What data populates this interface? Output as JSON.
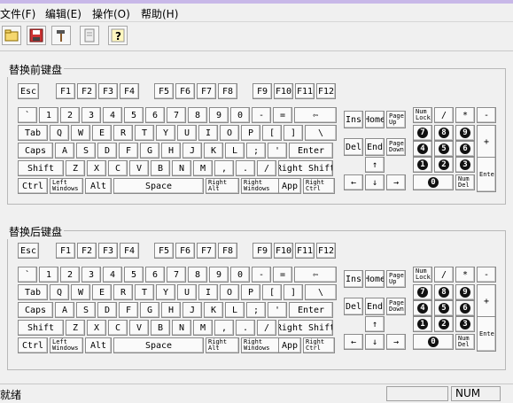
{
  "menu": [
    "文件(F)",
    "编辑(E)",
    "操作(O)",
    "帮助(H)"
  ],
  "toolbar": {
    "buttons": [
      {
        "name": "open-icon",
        "glyph": "📂"
      },
      {
        "name": "save-icon",
        "glyph": "💾"
      },
      {
        "name": "hammer-icon",
        "glyph": "🔨"
      },
      {
        "name": "print-preview-icon",
        "glyph": "🗎"
      },
      {
        "name": "help-icon",
        "glyph": "?"
      }
    ]
  },
  "groups": {
    "before_title": "替换前键盘",
    "after_title": "替换后键盘"
  },
  "keyboard": {
    "esc": "Esc",
    "f1_4": [
      "F1",
      "F2",
      "F3",
      "F4"
    ],
    "f5_8": [
      "F5",
      "F6",
      "F7",
      "F8"
    ],
    "f9_12": [
      "F9",
      "F10",
      "F11",
      "F12"
    ],
    "row_num": [
      "`",
      "1",
      "2",
      "3",
      "4",
      "5",
      "6",
      "7",
      "8",
      "9",
      "0",
      "-",
      "=",
      "⇦"
    ],
    "row_tab": [
      "Tab",
      "Q",
      "W",
      "E",
      "R",
      "T",
      "Y",
      "U",
      "I",
      "O",
      "P",
      "[",
      "]",
      "\\"
    ],
    "row_caps": [
      "Caps",
      "A",
      "S",
      "D",
      "F",
      "G",
      "H",
      "J",
      "K",
      "L",
      ";",
      "'",
      "Enter"
    ],
    "row_shift": [
      "Shift",
      "Z",
      "X",
      "C",
      "V",
      "B",
      "N",
      "M",
      ",",
      ".",
      "/",
      "Right Shift"
    ],
    "row_bottom": [
      "Ctrl",
      "Left\nWindows",
      "Alt",
      "Space",
      "Right\nAlt",
      "Right\nWindows",
      "App",
      "Right\nCtrl"
    ],
    "nav_top": [
      "Ins",
      "Home",
      "Page\nUp"
    ],
    "nav_bottom": [
      "Del",
      "End",
      "Page\nDown"
    ],
    "arrows": [
      "↑",
      "←",
      "↓",
      "→"
    ],
    "numpad_top": [
      "Num\nLock",
      "/",
      "*",
      "-"
    ],
    "numpad_7_9": [
      "7",
      "8",
      "9"
    ],
    "numpad_4_6": [
      "4",
      "5",
      "6"
    ],
    "numpad_1_3": [
      "1",
      "2",
      "3"
    ],
    "numpad_0": "0",
    "numpad_del": "Num\nDel",
    "numpad_plus": "+",
    "numpad_enter": "Enter"
  },
  "status": {
    "text": "就绪",
    "num": "NUM"
  }
}
